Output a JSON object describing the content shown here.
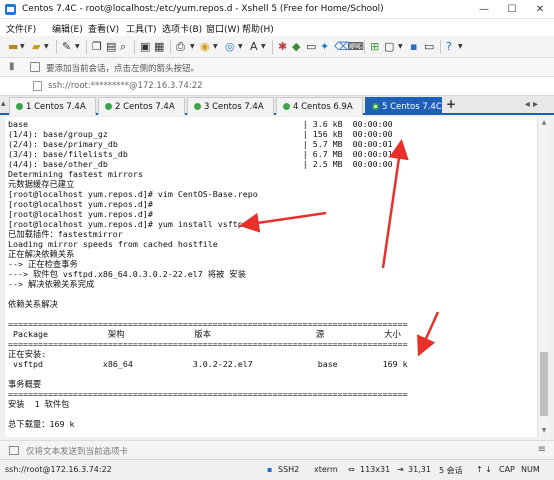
{
  "window": {
    "title": "Centos 7.4C - root@localhost:/etc/yum.repos.d - Xshell 5 (Free for Home/School)",
    "minimize": "—",
    "maximize": "☐",
    "close": "✕"
  },
  "menu": [
    "文件(F)",
    "编辑(E)",
    "查看(V)",
    "工具(T)",
    "选项卡(B)",
    "窗口(W)",
    "帮助(H)"
  ],
  "hint": "要添加当前会话，点击左侧的箭头按钮。",
  "address": "ssh://root:*********@172.16.3.74:22",
  "tabs": [
    {
      "label": "1 Centos 7.4A",
      "active": false
    },
    {
      "label": "2 Centos 7.4A",
      "active": false
    },
    {
      "label": "3 Centos 7.4A",
      "active": false
    },
    {
      "label": "4 Centos 6.9A",
      "active": false
    },
    {
      "label": "5 Centos 7.4C",
      "active": true
    }
  ],
  "tab_add": "+",
  "tab_nav": "◂ ▸",
  "terminal": [
    "base                                                       | 3.6 kB  00:00:00",
    "(1/4): base/group_gz                                       | 156 kB  00:00:00",
    "(2/4): base/primary_db                                     | 5.7 MB  00:00:01",
    "(3/4): base/filelists_db                                   | 6.7 MB  00:00:01",
    "(4/4): base/other_db                                       | 2.5 MB  00:00:00",
    "Determining fastest mirrors",
    "元数据缓存已建立",
    "[root@localhost yum.repos.d]# vim CentOS-Base.repo",
    "[root@localhost yum.repos.d]#",
    "[root@localhost yum.repos.d]#",
    "[root@localhost yum.repos.d]# yum install vsftpd",
    "已加载插件：fastestmirror",
    "Loading mirror speeds from cached hostfile",
    "正在解决依赖关系",
    "--> 正在检查事务",
    "---> 软件包 vsftpd.x86_64.0.3.0.2-22.el7 将被 安装",
    "--> 解决依赖关系完成",
    "",
    "依赖关系解决",
    "",
    "================================================================================",
    " Package            架构              版本                     源            大小",
    "================================================================================",
    "正在安装:",
    " vsftpd            x86_64            3.0.2-22.el7             base         169 k",
    "",
    "事务概要",
    "================================================================================",
    "安装  1 软件包",
    "",
    "总下载量：169 k"
  ],
  "compose": "仅将文本发送到当前选项卡",
  "status": {
    "session": "ssh://root@172.16.3.74:22",
    "protocol": "SSH2",
    "terminal": "xterm",
    "size": "113x31",
    "cursor": "31,31",
    "sessions": "5 会话",
    "caps": "CAP",
    "num": "NUM"
  },
  "colors": {
    "accent": "#1e5fb8",
    "tab_dot": "#3ca54a",
    "arrow": "#e8302a"
  }
}
